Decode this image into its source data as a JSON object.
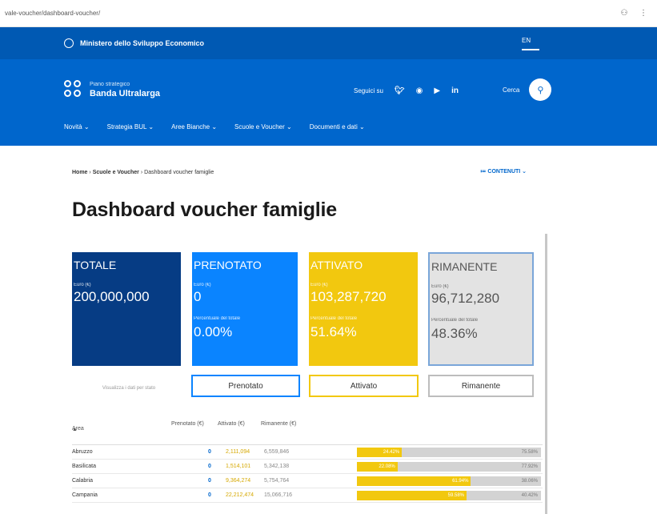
{
  "browser": {
    "url": "vale-voucher/dashboard-voucher/"
  },
  "topbar": {
    "ministry": "Ministero dello Sviluppo Economico",
    "lang": "EN"
  },
  "header": {
    "brand_small": "Piano strategico",
    "brand_big": "Banda Ultralarga",
    "follow": "Seguici su",
    "search": "Cerca",
    "nav": [
      "Novità",
      "Strategia BUL",
      "Aree Bianche",
      "Scuole e Voucher",
      "Documenti e dati"
    ]
  },
  "breadcrumb": {
    "home": "Home",
    "section": "Scuole e Voucher",
    "current": "Dashboard voucher famiglie"
  },
  "contents_label": "CONTENUTI",
  "page_title": "Dashboard voucher famiglie",
  "cards": [
    {
      "title": "TOTALE",
      "sub": "Euro (€)",
      "value": "200,000,000",
      "sub2": "",
      "pct": ""
    },
    {
      "title": "PRENOTATO",
      "sub": "Euro (€)",
      "value": "0",
      "sub2": "Percentuale del totale",
      "pct": "0.00%"
    },
    {
      "title": "ATTIVATO",
      "sub": "Euro (€)",
      "value": "103,287,720",
      "sub2": "Percentuale del totale",
      "pct": "51.64%"
    },
    {
      "title": "RIMANENTE",
      "sub": "Euro (€)",
      "value": "96,712,280",
      "sub2": "Percentuale del totale",
      "pct": "48.36%"
    }
  ],
  "filter_label": "Visualizza i dati per stato",
  "filters": [
    "Prenotato",
    "Attivato",
    "Rimanente"
  ],
  "table": {
    "headers": [
      "Area",
      "Prenotato (€)",
      "Attivato (€)",
      "Rimanente (€)"
    ],
    "rows": [
      {
        "area": "Abruzzo",
        "pre": "0",
        "att": "2,111,094",
        "rim": "6,559,846",
        "fill": 24.42,
        "fill_label": "24.42%",
        "rest_label": "75.58%"
      },
      {
        "area": "Basilicata",
        "pre": "0",
        "att": "1,514,101",
        "rim": "5,342,138",
        "fill": 22.08,
        "fill_label": "22.08%",
        "rest_label": "77.92%"
      },
      {
        "area": "Calabria",
        "pre": "0",
        "att": "9,364,274",
        "rim": "5,754,764",
        "fill": 61.94,
        "fill_label": "61.94%",
        "rest_label": "38.06%"
      },
      {
        "area": "Campania",
        "pre": "0",
        "att": "22,212,474",
        "rim": "15,066,716",
        "fill": 59.58,
        "fill_label": "59.58%",
        "rest_label": "40.42%"
      }
    ]
  }
}
